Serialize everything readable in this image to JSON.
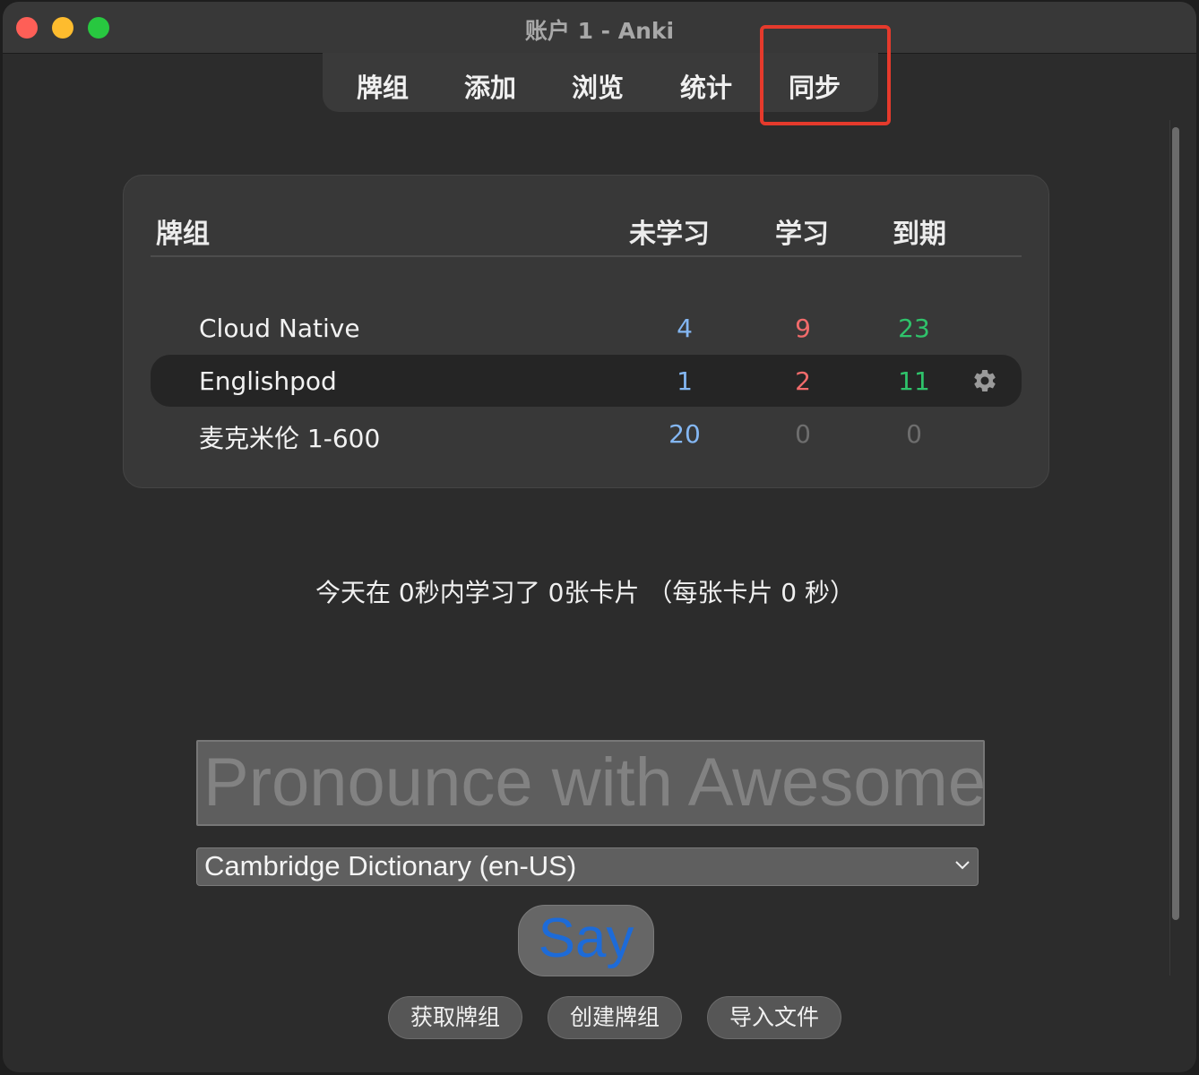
{
  "window": {
    "title": "账户 1 - Anki"
  },
  "toolbar": {
    "tabs": [
      {
        "label": "牌组"
      },
      {
        "label": "添加"
      },
      {
        "label": "浏览"
      },
      {
        "label": "统计"
      },
      {
        "label": "同步"
      }
    ],
    "highlighted_tab": "同步",
    "highlight_color": "#e53a2c"
  },
  "deck_table": {
    "headers": {
      "deck": "牌组",
      "new": "未学习",
      "learn": "学习",
      "due": "到期"
    },
    "rows": [
      {
        "name": "Cloud Native",
        "new": "4",
        "learn": "9",
        "due": "23",
        "selected": false
      },
      {
        "name": "Englishpod",
        "new": "1",
        "learn": "2",
        "due": "11",
        "selected": true
      },
      {
        "name": "麦克米伦 1-600",
        "new": "20",
        "learn": "0",
        "due": "0",
        "selected": false
      }
    ],
    "colors": {
      "new": "#84b7f3",
      "learn": "#f26b6b",
      "due": "#2fc36b",
      "zero": "#6e6e6e"
    }
  },
  "stats_text": "今天在 0秒内学习了 0张卡片 （每张卡片 0 秒）",
  "pronounce": {
    "input_placeholder": "Pronounce with Awesome TTS",
    "service_selected": "Cambridge Dictionary (en-US)",
    "say_label": "Say",
    "say_color": "#1d6bd8"
  },
  "bottom_buttons": {
    "get_shared": "获取牌组",
    "create_deck": "创建牌组",
    "import_file": "导入文件"
  }
}
